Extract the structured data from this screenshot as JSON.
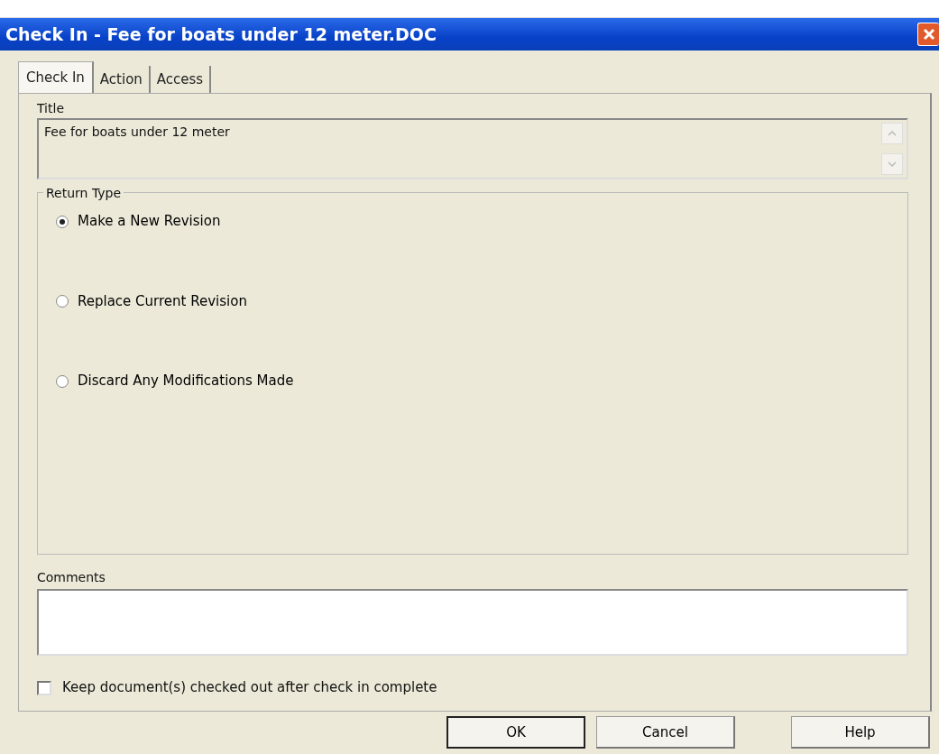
{
  "window": {
    "title": "Check In - Fee for boats under 12 meter.DOC"
  },
  "tabs": [
    {
      "label": "Check In",
      "selected": true
    },
    {
      "label": "Action",
      "selected": false
    },
    {
      "label": "Access",
      "selected": false
    }
  ],
  "title_field": {
    "label": "Title",
    "value": "Fee for boats under 12 meter",
    "disabled": true
  },
  "return_type": {
    "label": "Return Type",
    "options": [
      {
        "label": "Make a New Revision",
        "selected": true
      },
      {
        "label": "Replace Current Revision",
        "selected": false
      },
      {
        "label": "Discard Any Modifications Made",
        "selected": false
      }
    ]
  },
  "comments": {
    "label": "Comments"
  },
  "keep_checked_out": {
    "label": "Keep document(s) checked out after check in complete",
    "checked": false
  },
  "buttons": [
    {
      "label": "OK",
      "default": true
    },
    {
      "label": "Cancel",
      "default": false
    },
    {
      "label": "Help",
      "default": false
    }
  ]
}
